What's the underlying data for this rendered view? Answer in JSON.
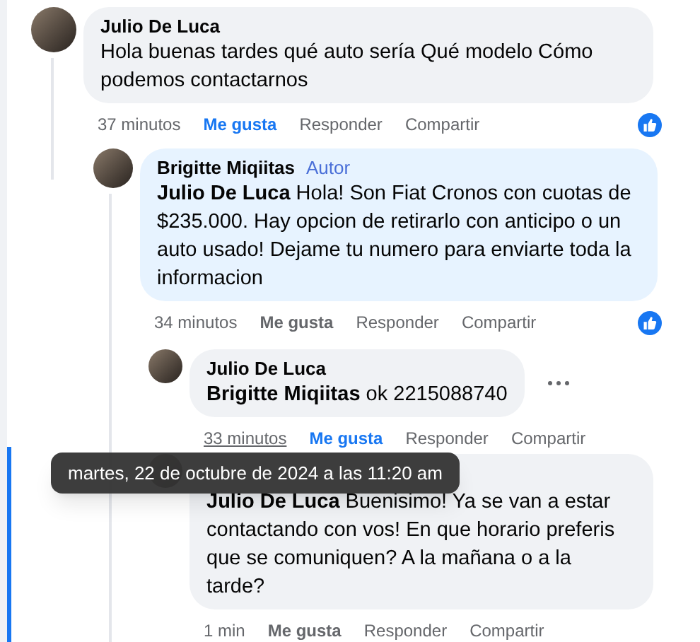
{
  "comments": [
    {
      "author": "Julio De Luca",
      "text": "Hola buenas tardes qué auto sería Qué modelo Cómo podemos contactarnos",
      "time": "37 minutos",
      "time_hovered": false,
      "liked_by_me": true,
      "reaction_badge": true,
      "more_menu": false,
      "highlighted": false,
      "actions": [
        "Me gusta",
        "Responder",
        "Compartir"
      ],
      "children": [
        {
          "author": "Brigitte Miqiitas",
          "badge": "Autor",
          "text": "**Julio De Luca** Hola! Son Fiat Cronos con cuotas de $235.000. Hay opcion de retirarlo con anticipo o un auto usado! Dejame tu numero para enviarte toda la informacion",
          "time": "34 minutos",
          "time_hovered": false,
          "liked_by_me": false,
          "reaction_badge": true,
          "more_menu": false,
          "highlighted": false,
          "actions": [
            "Me gusta",
            "Responder",
            "Compartir"
          ],
          "children": [
            {
              "author": "Julio De Luca",
              "text": "**Brigitte Miqiitas** ok 2215088740",
              "time": "33 minutos",
              "time_hovered": true,
              "liked_by_me": true,
              "reaction_badge": false,
              "more_menu": true,
              "highlighted": false,
              "actions": [
                "Me gusta",
                "Responder",
                "Compartir"
              ]
            },
            {
              "text": "**Julio De Luca** Buenisimo! Ya se van a estar contactando con vos! En que horario preferis que se comuniquen? A la mañana o a la tarde?",
              "time": "1 min",
              "time_hovered": false,
              "liked_by_me": false,
              "reaction_badge": false,
              "more_menu": false,
              "highlighted": true,
              "actions": [
                "Me gusta",
                "Responder",
                "Compartir"
              ]
            }
          ]
        }
      ]
    }
  ],
  "tooltip": "martes, 22 de octubre de 2024 a las 11:20 am"
}
